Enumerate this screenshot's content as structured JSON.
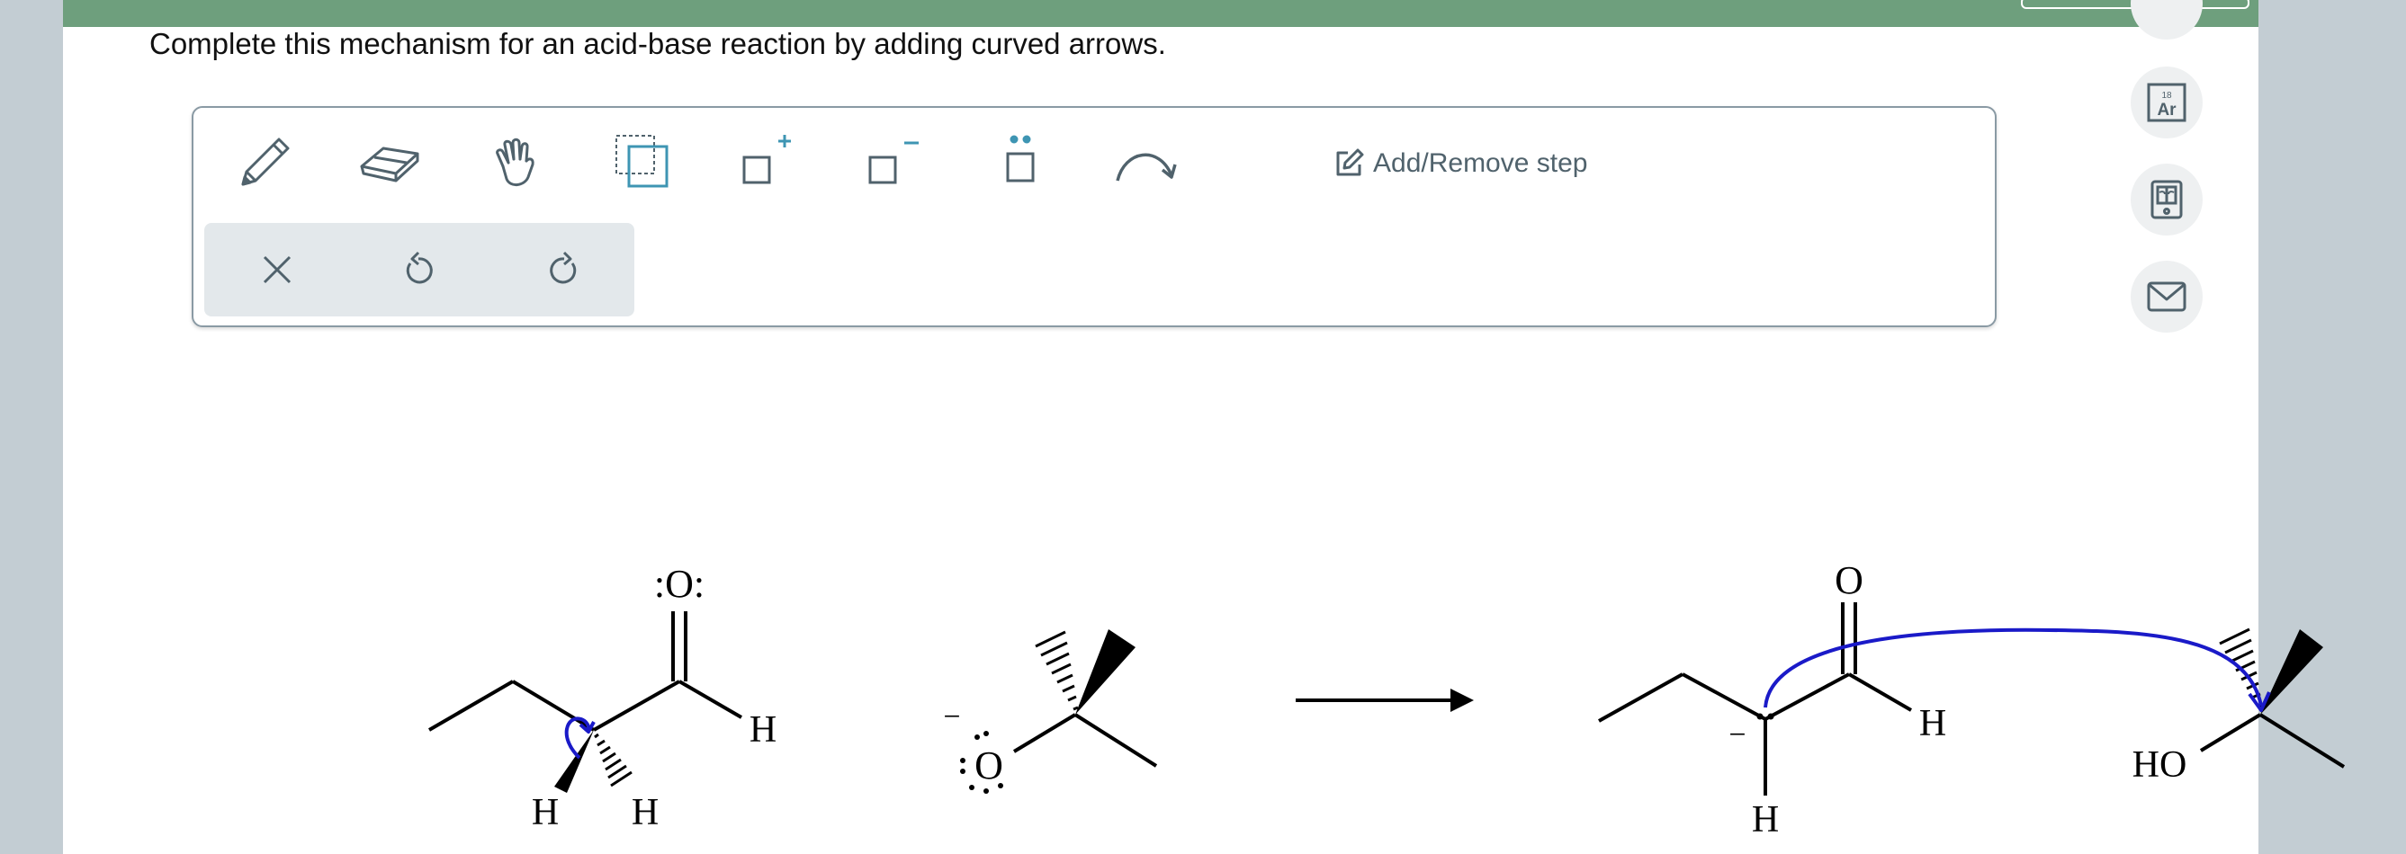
{
  "instructions": "Complete this mechanism for an acid-base reaction by adding curved arrows.",
  "toolbar": {
    "tools": [
      {
        "name": "pencil-icon"
      },
      {
        "name": "eraser-icon"
      },
      {
        "name": "hand-icon"
      },
      {
        "name": "select-icon"
      },
      {
        "name": "add-charge-icon"
      },
      {
        "name": "remove-charge-icon"
      },
      {
        "name": "lone-pair-icon"
      },
      {
        "name": "curved-arrow-icon"
      }
    ],
    "add_remove_step": "Add/Remove step",
    "actions": [
      {
        "name": "clear-icon"
      },
      {
        "name": "undo-icon"
      },
      {
        "name": "redo-icon"
      }
    ]
  },
  "side_buttons": [
    {
      "name": "periodic-table-icon",
      "atomic_number": "18",
      "symbol": "Ar"
    },
    {
      "name": "calculator-icon"
    },
    {
      "name": "mail-icon"
    }
  ],
  "mechanism": {
    "reactant1": {
      "oxygen": ":O:",
      "h_right": "H",
      "h_left": "H",
      "h_right_bottom": "H"
    },
    "reactant2": {
      "charge": "−",
      "oxygen": "O"
    },
    "product1": {
      "oxygen": "O",
      "h_right": "H",
      "h_bottom": "H",
      "charge": "−"
    },
    "product2": {
      "ho": "HO"
    }
  },
  "colors": {
    "header": "#6e9f7d",
    "arrow": "#1a1ac8",
    "icon": "#50626c",
    "icon_accent": "#3e95b3"
  }
}
